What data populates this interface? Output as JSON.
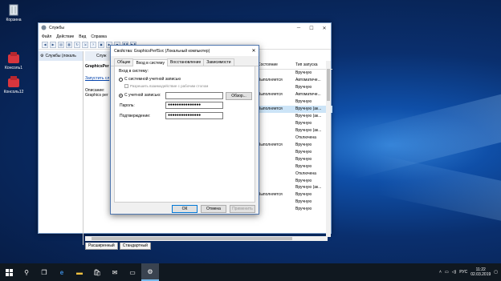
{
  "desktop": {
    "icons": [
      {
        "label": "Корзина",
        "icon": "recycle-bin-icon"
      },
      {
        "label": "Консоль1",
        "icon": "console-icon"
      },
      {
        "label": "Консоль12",
        "icon": "console-icon"
      }
    ]
  },
  "services_window": {
    "title": "Службы",
    "menu": [
      "Файл",
      "Действие",
      "Вид",
      "Справка"
    ],
    "tree_item": "Службы (локаль",
    "mid_header": "Служ",
    "service_name": "GraphicsPer",
    "start_link": "Запустить сл",
    "description_label": "Описание:",
    "description_text": "Graphics per",
    "columns": {
      "status": "Состояние",
      "startup": "Тип запуска"
    },
    "rows": [
      {
        "status": "",
        "startup": "Вручную"
      },
      {
        "status": "Выполняется",
        "startup": "Автоматиче..."
      },
      {
        "status": "",
        "startup": "Вручную"
      },
      {
        "status": "Выполняется",
        "startup": "Автоматиче..."
      },
      {
        "status": "",
        "startup": "Вручную"
      },
      {
        "status": "Выполняется",
        "startup": "Вручную (ак..."
      },
      {
        "status": "",
        "startup": "Вручную (ак..."
      },
      {
        "status": "",
        "startup": "Вручную"
      },
      {
        "status": "",
        "startup": "Вручную (ак..."
      },
      {
        "status": "",
        "startup": "Отключена"
      },
      {
        "status": "Выполняется",
        "startup": "Вручную"
      },
      {
        "status": "",
        "startup": "Вручную"
      },
      {
        "status": "",
        "startup": "Вручную"
      },
      {
        "status": "",
        "startup": "Вручную"
      },
      {
        "status": "",
        "startup": "Отключена"
      },
      {
        "status": "",
        "startup": "Вручную"
      },
      {
        "status": "",
        "startup": "Вручную (ак..."
      },
      {
        "status": "Выполняется",
        "startup": "Вручную"
      },
      {
        "status": "",
        "startup": "Вручную"
      },
      {
        "status": "",
        "startup": "Вручную"
      }
    ],
    "selected_row": 5,
    "bottom_tabs": [
      "Расширенный",
      "Стандартный"
    ]
  },
  "dialog": {
    "title": "Свойства: GraphicsPerfSvc (Локальный компьютер)",
    "tabs": [
      "Общие",
      "Вход в систему",
      "Восстановление",
      "Зависимости"
    ],
    "active_tab": 1,
    "logon_as": "Вход в систему:",
    "radio_system": "С системной учетной записью",
    "checkbox_desktop": "Разрешить взаимодействие с рабочим столом",
    "radio_account": "С учетной записью:",
    "account_value": "",
    "browse_button": "Обзор...",
    "password_label": "Пароль:",
    "password_value": "●●●●●●●●●●●●●●●",
    "confirm_label": "Подтверждение:",
    "confirm_value": "●●●●●●●●●●●●●●●",
    "ok": "ОК",
    "cancel": "Отмена",
    "apply": "Применить"
  },
  "taskbar": {
    "lang": "РУС",
    "time": "11:22",
    "date": "02.03.2019"
  }
}
